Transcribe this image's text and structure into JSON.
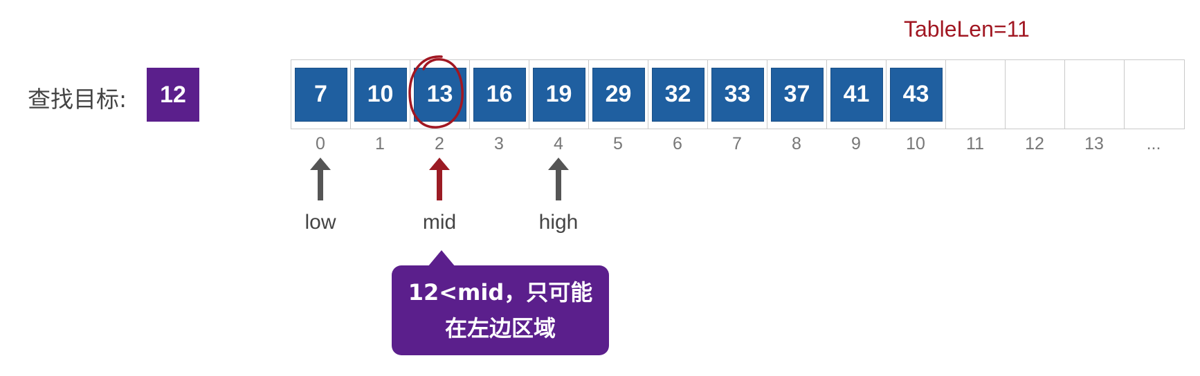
{
  "table_len_label": "TableLen=11",
  "target": {
    "label": "查找目标:",
    "value": "12"
  },
  "array": {
    "values": [
      "7",
      "10",
      "13",
      "16",
      "19",
      "29",
      "32",
      "33",
      "37",
      "41",
      "43",
      "",
      "",
      "",
      ""
    ],
    "indices": [
      "0",
      "1",
      "2",
      "3",
      "4",
      "5",
      "6",
      "7",
      "8",
      "9",
      "10",
      "11",
      "12",
      "13",
      "..."
    ],
    "highlighted_value": "13"
  },
  "pointers": {
    "low": {
      "label": "low",
      "index": 0,
      "color": "#555555"
    },
    "mid": {
      "label": "mid",
      "index": 2,
      "color": "#9b1b24"
    },
    "high": {
      "label": "high",
      "index": 4,
      "color": "#555555"
    }
  },
  "callout": {
    "line1": "12<mid，只可能",
    "line2": "在左边区域"
  },
  "colors": {
    "cell_fill": "#1f5fa0",
    "target_fill": "#5b1f8c",
    "accent_red": "#a11722"
  }
}
